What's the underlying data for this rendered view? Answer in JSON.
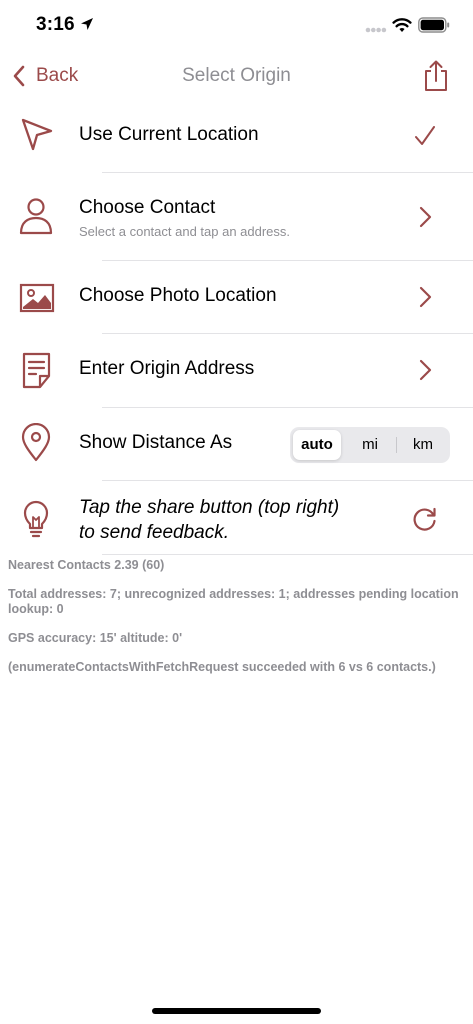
{
  "status": {
    "time": "3:16"
  },
  "nav": {
    "back_label": "Back",
    "title": "Select Origin"
  },
  "rows": [
    {
      "title": "Use Current Location",
      "icon": "location-arrow-icon",
      "accessory": "checkmark-icon"
    },
    {
      "title": "Choose Contact",
      "subtitle": "Select a contact and tap an address.",
      "icon": "person-icon",
      "accessory": "chevron-right-icon"
    },
    {
      "title": "Choose Photo Location",
      "icon": "photo-icon",
      "accessory": "chevron-right-icon"
    },
    {
      "title": "Enter Origin Address",
      "icon": "document-icon",
      "accessory": "chevron-right-icon"
    },
    {
      "title": "Show Distance As",
      "icon": "map-pin-icon"
    }
  ],
  "distance_units": {
    "options": [
      "auto",
      "mi",
      "km"
    ],
    "selected": "auto"
  },
  "hint": {
    "line1": "Tap the share button (top right)",
    "line2": "to send feedback.",
    "icon": "lightbulb-icon",
    "accessory": "refresh-icon"
  },
  "info": [
    "Nearest Contacts 2.39 (60)",
    "Total addresses: 7; unrecognized addresses: 1; addresses pending location lookup: 0",
    "GPS accuracy: 15' altitude: 0'",
    "(enumerateContactsWithFetchRequest succeeded with 6 vs 6 contacts.)"
  ],
  "colors": {
    "accent": "#9B4A4A",
    "secondary_text": "#8E8E93",
    "separator": "#E3E3E6"
  }
}
